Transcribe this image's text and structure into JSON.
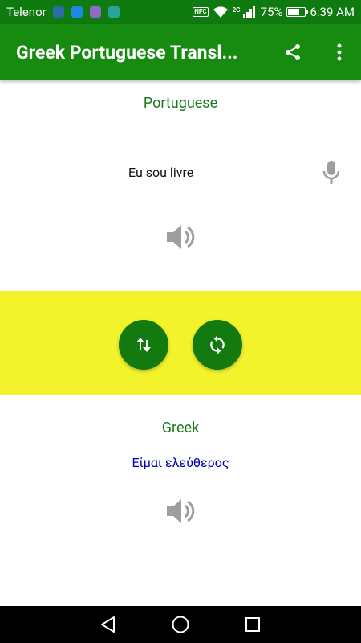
{
  "status_bar": {
    "carrier": "Telenor",
    "battery_percent": "75%",
    "time": "6:39 AM",
    "network": "2G",
    "nfc": "NFC",
    "battery_level": 0.75
  },
  "app_bar": {
    "title": "Greek Portuguese Transl...",
    "share_icon": "share-icon",
    "menu_icon": "more-vert-icon"
  },
  "source": {
    "language": "Portuguese",
    "text": "Eu sou livre",
    "mic_icon": "mic-icon",
    "speaker_icon": "speaker-icon"
  },
  "controls": {
    "swap_icon": "swap-vertical-icon",
    "refresh_icon": "sync-icon"
  },
  "target": {
    "language": "Greek",
    "text": "Είμαι ελεύθερος",
    "speaker_icon": "speaker-icon"
  },
  "nav_bar": {
    "back_icon": "back-triangle-icon",
    "home_icon": "home-circle-icon",
    "recents_icon": "recents-square-icon"
  },
  "colors": {
    "primary": "#168b10",
    "status_bar": "#0f7a0f",
    "accent_band": "#f3f32c",
    "fab": "#137a10",
    "language_label": "#1a7a1a",
    "translated_text": "#0000b0",
    "icon_gray": "#9e9e9e"
  }
}
